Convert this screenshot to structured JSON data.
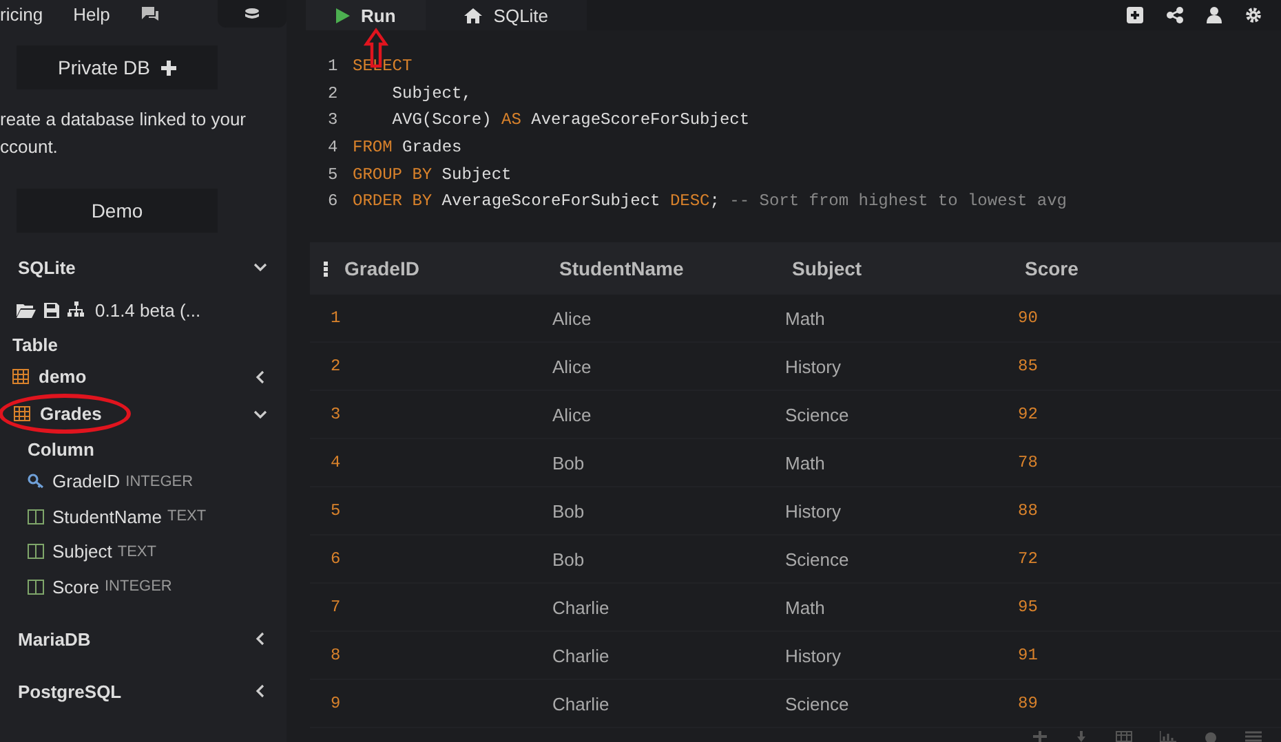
{
  "top_links": [
    {
      "label": "ricing"
    },
    {
      "label": "Help"
    }
  ],
  "private_db_button": "Private DB",
  "description": "reate a database linked to your ccount.",
  "demo_button": "Demo",
  "engines": [
    {
      "name": "SQLite",
      "expanded": true,
      "version": "0.1.4 beta (...",
      "tables_heading": "Table",
      "tables": [
        {
          "name": "demo",
          "expanded": false,
          "circled": false
        },
        {
          "name": "Grades",
          "expanded": true,
          "circled": true,
          "columns_heading": "Column",
          "columns": [
            {
              "name": "GradeID",
              "type": "INTEGER",
              "kind": "key"
            },
            {
              "name": "StudentName",
              "type": "TEXT",
              "kind": "column"
            },
            {
              "name": "Subject",
              "type": "TEXT",
              "kind": "column"
            },
            {
              "name": "Score",
              "type": "INTEGER",
              "kind": "column"
            }
          ]
        }
      ]
    },
    {
      "name": "MariaDB",
      "expanded": false
    },
    {
      "name": "PostgreSQL",
      "expanded": false
    }
  ],
  "tabs": [
    {
      "label": "Run",
      "kind": "run",
      "selected": true,
      "arrow": true
    },
    {
      "label": "SQLite",
      "kind": "home",
      "selected": false,
      "arrow": false
    }
  ],
  "editor": {
    "lines": [
      {
        "number": "1",
        "tokens": [
          {
            "text": "SELECT",
            "kind": "keyword"
          }
        ]
      },
      {
        "number": "2",
        "tokens": [
          {
            "text": "    Subject,",
            "kind": "plain"
          }
        ]
      },
      {
        "number": "3",
        "tokens": [
          {
            "text": "    AVG(Score) ",
            "kind": "plain"
          },
          {
            "text": "AS",
            "kind": "keyword"
          },
          {
            "text": " AverageScoreForSubject",
            "kind": "plain"
          }
        ]
      },
      {
        "number": "4",
        "tokens": [
          {
            "text": "FROM",
            "kind": "keyword"
          },
          {
            "text": " Grades",
            "kind": "plain"
          }
        ]
      },
      {
        "number": "5",
        "tokens": [
          {
            "text": "GROUP BY",
            "kind": "keyword"
          },
          {
            "text": " Subject",
            "kind": "plain"
          }
        ]
      },
      {
        "number": "6",
        "tokens": [
          {
            "text": "ORDER BY",
            "kind": "keyword"
          },
          {
            "text": " AverageScoreForSubject ",
            "kind": "plain"
          },
          {
            "text": "DESC",
            "kind": "keyword"
          },
          {
            "text": "; ",
            "kind": "plain"
          },
          {
            "text": "-- Sort from highest to lowest avg",
            "kind": "comment"
          }
        ]
      }
    ]
  },
  "table": {
    "columns": [
      {
        "label": "GradeID",
        "kind": "number"
      },
      {
        "label": "StudentName",
        "kind": "text"
      },
      {
        "label": "Subject",
        "kind": "text"
      },
      {
        "label": "Score",
        "kind": "number"
      }
    ],
    "rows": [
      [
        "1",
        "Alice",
        "Math",
        "90"
      ],
      [
        "2",
        "Alice",
        "History",
        "85"
      ],
      [
        "3",
        "Alice",
        "Science",
        "92"
      ],
      [
        "4",
        "Bob",
        "Math",
        "78"
      ],
      [
        "5",
        "Bob",
        "History",
        "88"
      ],
      [
        "6",
        "Bob",
        "Science",
        "72"
      ],
      [
        "7",
        "Charlie",
        "Math",
        "95"
      ],
      [
        "8",
        "Charlie",
        "History",
        "91"
      ],
      [
        "9",
        "Charlie",
        "Science",
        "89"
      ]
    ]
  }
}
